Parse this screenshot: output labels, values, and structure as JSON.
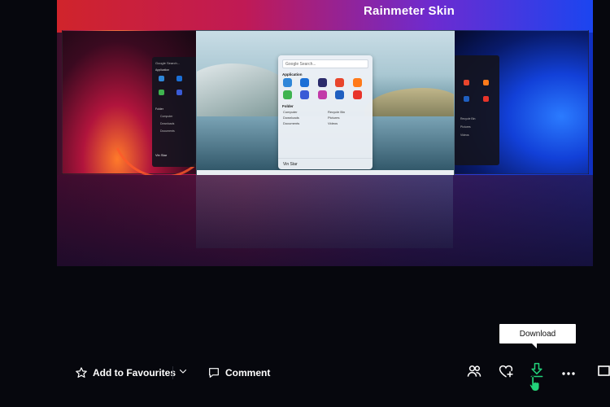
{
  "artwork": {
    "title": "Rainmeter Skin",
    "start_menu": {
      "search_placeholder": "Google Search...",
      "section_apps": "Application",
      "section_folder": "Folder",
      "folders": [
        "Computer",
        "Recycle Bin",
        "Downloads",
        "Pictures",
        "Documents",
        "Videos"
      ],
      "user": "Vin Star"
    },
    "left_menu": {
      "search_placeholder": "Google Search...",
      "section_apps": "Application",
      "section_folder": "Folder",
      "folders": [
        "Computer",
        "Downloads",
        "Documents"
      ],
      "user": "Vin Star"
    },
    "right_menu": {
      "folders": [
        "Recycle Bin",
        "Pictures",
        "Videos"
      ]
    },
    "app_colors": [
      "#2f86d8",
      "#1b6fd6",
      "#2b2b6b",
      "#e8452c",
      "#ff7a1a",
      "#3fb34f",
      "#3a5bd6",
      "#c23aa8",
      "#1f5fc0",
      "#e8342a"
    ]
  },
  "tooltip": {
    "text": "Download"
  },
  "actions": {
    "favourite_label": "Add to Favourites",
    "comment_label": "Comment"
  },
  "colors": {
    "background": "#06070d",
    "download_accent": "#22d37a"
  }
}
